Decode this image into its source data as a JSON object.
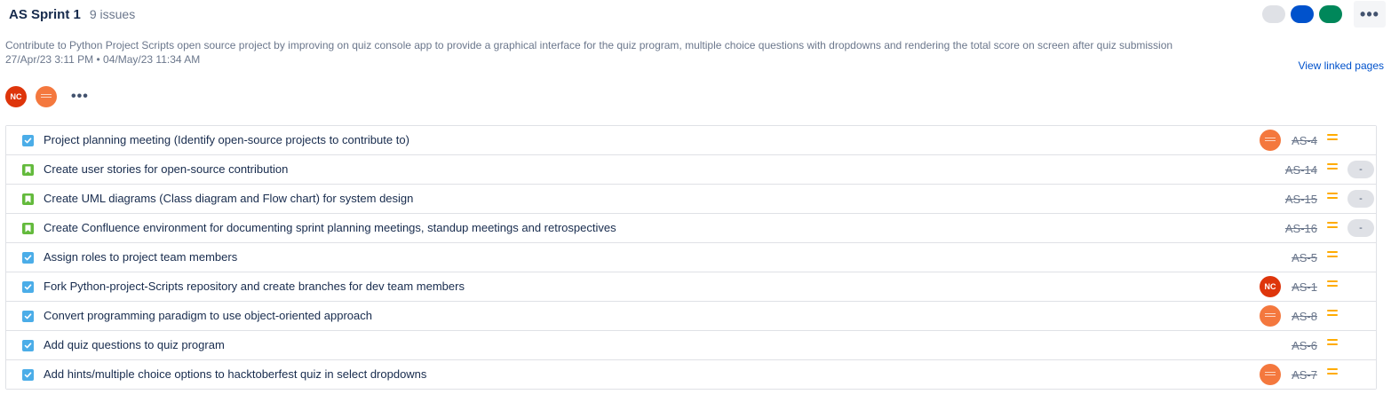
{
  "sprint": {
    "title": "AS Sprint 1",
    "issue_count": "9 issues",
    "goal": "Contribute to Python Project Scripts open source project by improving on quiz console app to provide a graphical interface for the quiz program, multiple choice questions with dropdowns and rendering the total score on screen after quiz submission",
    "dates": "27/Apr/23 3:11 PM  •  04/May/23 11:34 AM",
    "linked_label": "View linked pages",
    "status_colors": [
      "#dfe1e6",
      "#0052cc",
      "#00875a"
    ],
    "more_label": "•••"
  },
  "assignees": [
    {
      "initials": "NC",
      "color": "#de350b"
    },
    {
      "initials": "",
      "color": "#f4783e"
    }
  ],
  "assignees_more": "•••",
  "issues": [
    {
      "type": "task",
      "summary": "Project planning meeting (Identify open-source projects to contribute to)",
      "key": "AS-4",
      "avatar": "org",
      "estimate": ""
    },
    {
      "type": "story",
      "summary": "Create user stories for open-source contribution",
      "key": "AS-14",
      "avatar": "",
      "estimate": "-"
    },
    {
      "type": "story",
      "summary": "Create UML diagrams (Class diagram and Flow chart) for system design",
      "key": "AS-15",
      "avatar": "",
      "estimate": "-"
    },
    {
      "type": "story",
      "summary": "Create Confluence environment for documenting sprint planning meetings, standup meetings and retrospectives",
      "key": "AS-16",
      "avatar": "",
      "estimate": "-"
    },
    {
      "type": "task",
      "summary": "Assign roles to project team members",
      "key": "AS-5",
      "avatar": "",
      "estimate": ""
    },
    {
      "type": "task",
      "summary": "Fork Python-project-Scripts repository and create branches for dev team members",
      "key": "AS-1",
      "avatar": "nc",
      "estimate": ""
    },
    {
      "type": "task",
      "summary": "Convert programming paradigm to use object-oriented approach",
      "key": "AS-8",
      "avatar": "org",
      "estimate": ""
    },
    {
      "type": "task",
      "summary": "Add quiz questions to quiz program",
      "key": "AS-6",
      "avatar": "",
      "estimate": ""
    },
    {
      "type": "task",
      "summary": "Add hints/multiple choice options to hacktoberfest quiz in select dropdowns",
      "key": "AS-7",
      "avatar": "org",
      "estimate": ""
    }
  ],
  "priority_icon": "medium-priority-icon",
  "priority_color": "#ffab00"
}
